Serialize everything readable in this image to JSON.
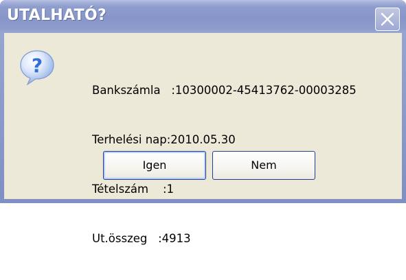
{
  "dialog": {
    "title": "UTALHATÓ?",
    "close_icon": "close-icon",
    "icon": "question-icon"
  },
  "info": {
    "rows": [
      "Bankszámla   :10300002-45413762-00003285",
      "Terhelési nap:2010.05.30",
      "Tételszám    :1",
      "Ut.összeg   :4913"
    ]
  },
  "buttons": {
    "yes_label": "Igen",
    "no_label": "Nem"
  },
  "colors": {
    "title_bar": "#8796c8",
    "client_bg": "#ece9d8",
    "button_border": "#1c3f94",
    "icon_blue": "#2f6fd6"
  }
}
